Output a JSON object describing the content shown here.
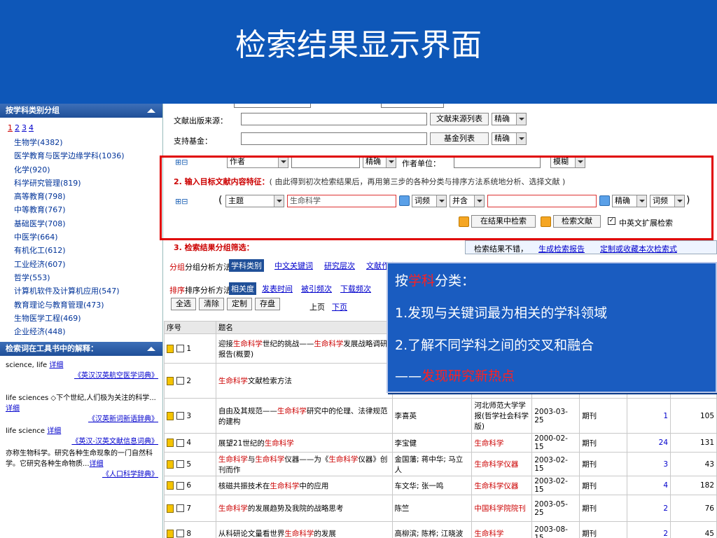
{
  "slide_title": "检索结果显示界面",
  "sidebar": {
    "header1": "按学科类别分组",
    "pages": [
      "1",
      "2",
      "3",
      "4"
    ],
    "items": [
      "生物学(4382)",
      "医学教育与医学边缘学科(1036)",
      "化学(920)",
      "科学研究管理(819)",
      "高等教育(798)",
      "中等教育(767)",
      "基础医学(708)",
      "中医学(664)",
      "有机化工(612)",
      "工业经济(607)",
      "哲学(553)",
      "计算机软件及计算机应用(547)",
      "教育理论与教育管理(473)",
      "生物医学工程(469)",
      "企业经济(448)"
    ],
    "header2": "检索词在工具书中的解释：",
    "dict": [
      {
        "text": "science, life ",
        "link": "详细",
        "source": "《英汉汉英航空医学词典》"
      },
      {
        "text": "life sciences ◇下个世纪,人们极为关注的科学...",
        "link": "详细",
        "source": "《汉英新词新语辞典》"
      },
      {
        "text": "life science ",
        "link": "详细",
        "source": "《英汉-汉英文献信息词典》"
      },
      {
        "text": "亦称生物科学。研究各种生命现象的一门自然科学。它研究各种生命物质...",
        "link": "详细",
        "source": "《人口科学辞典》"
      }
    ]
  },
  "form": {
    "source_label": "文献出版来源：",
    "source_list_btn": "文献来源列表",
    "precise": "精确",
    "fund_label": "支持基金：",
    "fund_list_btn": "基金列表",
    "author_sel": "作者",
    "author_unit_label": "作者单位：",
    "fuzzy": "模糊",
    "step2_label": "2. 输入目标文献内容特征：",
    "step2_hint": "( 由此得到初次检索结果后，再用第三步的各种分类与排序方法系统地分析、选择文献 )",
    "paren_open": "(",
    "paren_close": ")",
    "topic_sel": "主题",
    "topic_value": "生命科学",
    "freq": "词频",
    "and_sel": "并含",
    "search_in_results": "在结果中检索",
    "search_btn": "检索文献",
    "cn_en_ext": "中英文扩展检索",
    "step3_label": "3. 检索结果分组筛选：",
    "not_satisfied": "检索结果不错，",
    "gen_report": "生成检索报告",
    "customize": "定制或收藏本次检索式",
    "group_label": "分组分析方法:",
    "group_prefix": "分组",
    "group_active": "学科类别",
    "group_links": [
      "中文关键词",
      "研究层次",
      "文献作者"
    ],
    "sort_label": "排序分析方法:",
    "sort_prefix": "排序",
    "sort_active": "相关度",
    "sort_links": [
      "发表时间",
      "被引频次",
      "下载频次"
    ],
    "btn_all": "全选",
    "btn_clear": "清除",
    "btn_custom": "定制",
    "btn_save": "存盘",
    "prev_page": "上页",
    "next_page": "下页"
  },
  "table": {
    "headers": [
      "序号",
      "题名"
    ],
    "rows": [
      {
        "no": "1",
        "title": [
          "迎接",
          "生命科学",
          "世纪的挑战——",
          "生命科学",
          "发展战略调研报告(概要)"
        ],
        "author": "",
        "source": "",
        "date": "",
        "type": "",
        "cited": "",
        "dl": ""
      },
      {
        "no": "2",
        "title": [
          "",
          "生命科学",
          "文献检索方法"
        ],
        "author": "",
        "source": "",
        "date": "",
        "type": "",
        "cited": "",
        "dl": ""
      },
      {
        "no": "3",
        "title": [
          "自由及其规范——",
          "生命科学",
          "研究中的伦理、法律规范的建构"
        ],
        "author": "李喜英",
        "source": "河北师范大学学报(哲学社会科学版)",
        "date": "2003-03-25",
        "type": "期刊",
        "cited": "1",
        "dl": "105"
      },
      {
        "no": "4",
        "title": [
          "展望21世纪的",
          "生命科学",
          ""
        ],
        "author": "李宝健",
        "source": "生命科学",
        "date": "2000-02-15",
        "type": "期刊",
        "cited": "24",
        "dl": "131"
      },
      {
        "no": "5",
        "title": [
          "",
          "生命科学",
          "与",
          "生命科学",
          "仪器——为《",
          "生命科学",
          "仪器》创刊而作"
        ],
        "author": "金国藩; 蒋中华; 马立人",
        "source": "生命科学仪器",
        "date": "2003-02-15",
        "type": "期刊",
        "cited": "3",
        "dl": "43"
      },
      {
        "no": "6",
        "title": [
          "核磁共振技术在",
          "生命科学",
          "中的应用"
        ],
        "author": "车文华; 张一鸣",
        "source": "生命科学仪器",
        "date": "2003-02-15",
        "type": "期刊",
        "cited": "4",
        "dl": "182"
      },
      {
        "no": "7",
        "title": [
          "",
          "生命科学",
          "的发展趋势及我院的战略思考"
        ],
        "author": "陈竺",
        "source": "中国科学院院刊",
        "date": "2003-05-25",
        "type": "期刊",
        "cited": "2",
        "dl": "76"
      },
      {
        "no": "8",
        "title": [
          "从科研论文量看世界",
          "生命科学",
          "的发展"
        ],
        "author": "高柳滨; 陈桦; 江晓波",
        "source": "生命科学",
        "date": "2003-08-15",
        "type": "期刊",
        "cited": "2",
        "dl": "45"
      }
    ]
  },
  "callout": {
    "line1_pre": "按",
    "line1_red": "学科",
    "line1_post": "分类：",
    "line2": "1.发现与关键词最为相关的学科领域",
    "line3": "2.了解不同学科之间的交叉和融合",
    "line4_dash": "——",
    "line4_red": "发现研究新热点"
  },
  "colors": {
    "slide_bg": "#0e57b8",
    "highlight": "#cc0000",
    "box_border": "#e00000",
    "callout_bg": "#1a5cc0"
  }
}
